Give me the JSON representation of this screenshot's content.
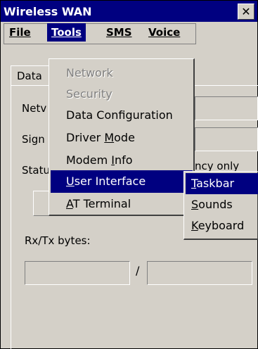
{
  "window": {
    "title": "Wireless WAN",
    "close_glyph": "✕"
  },
  "menubar": {
    "items": [
      "File",
      "Tools",
      "SMS",
      "Voice"
    ]
  },
  "tab": {
    "label": "Data"
  },
  "form": {
    "network_label": "Netv",
    "signal_label": "Sign",
    "status_label": "Statu",
    "status_value_clip": "ncy only",
    "rxtx_label": "Rx/Tx bytes:",
    "separator": "/"
  },
  "tools_menu": {
    "items": [
      {
        "label": "Network",
        "enabled": false
      },
      {
        "label": "Security",
        "enabled": false
      },
      {
        "label": "Data Configuration",
        "enabled": true
      },
      {
        "label": "Driver Mode",
        "enabled": true
      },
      {
        "label": "Modem Info",
        "enabled": true
      },
      {
        "label": "User Interface",
        "enabled": true,
        "highlighted": true,
        "has_submenu": true
      },
      {
        "label": "AT Terminal",
        "enabled": true
      }
    ]
  },
  "user_interface_submenu": {
    "items": [
      {
        "label": "Taskbar",
        "highlighted": true
      },
      {
        "label": "Sounds"
      },
      {
        "label": "Keyboard"
      }
    ]
  },
  "colors": {
    "highlight": "#000080",
    "face": "#d4d0c8",
    "disabled_text": "#808080"
  }
}
